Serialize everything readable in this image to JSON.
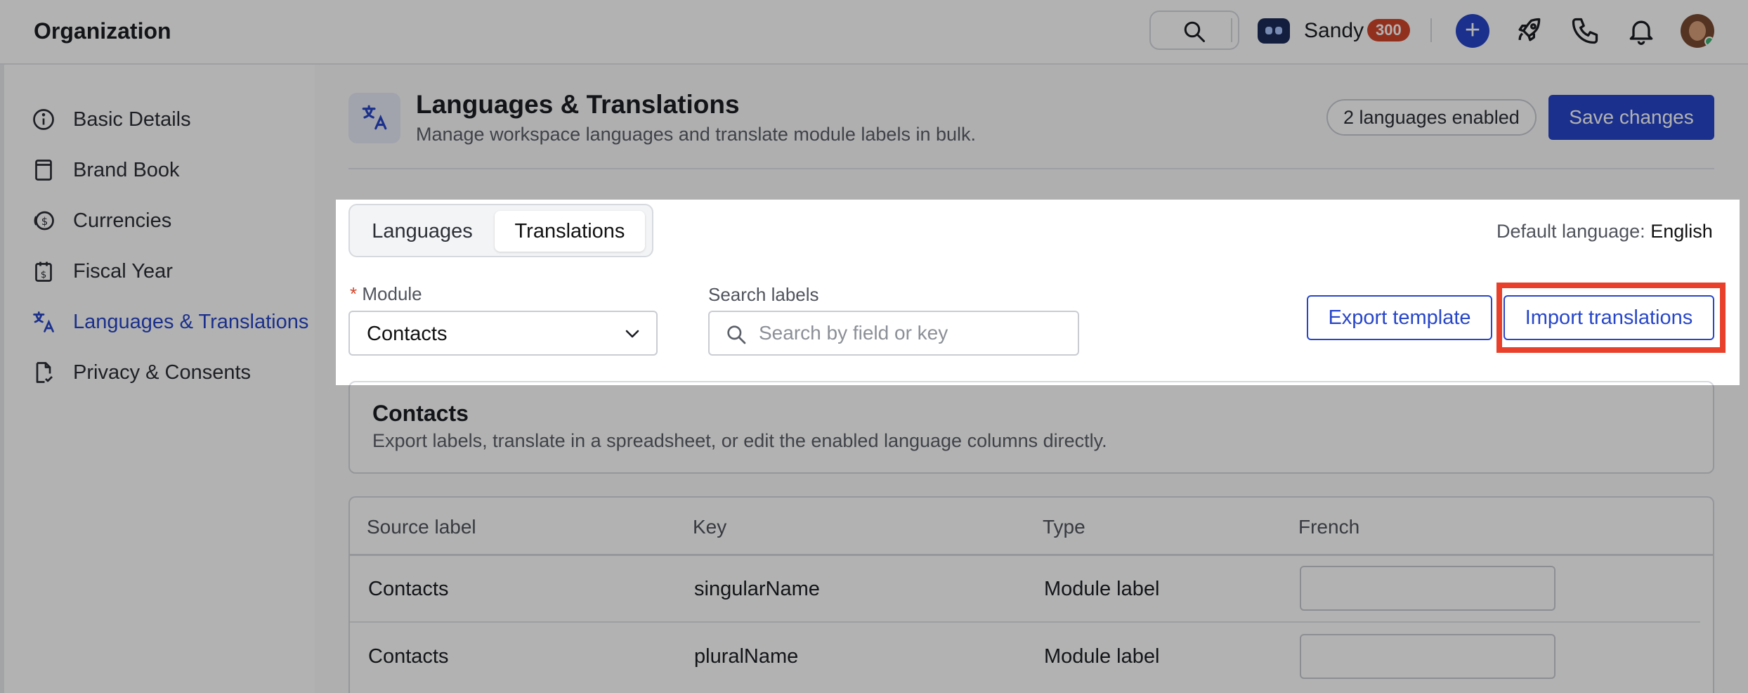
{
  "header": {
    "org_title": "Organization",
    "user_name": "Sandy",
    "count_badge": "300"
  },
  "sidebar": {
    "items": [
      {
        "label": "Basic Details",
        "icon": "info-icon",
        "active": false
      },
      {
        "label": "Brand Book",
        "icon": "book-icon",
        "active": false
      },
      {
        "label": "Currencies",
        "icon": "coins-icon",
        "active": false
      },
      {
        "label": "Fiscal Year",
        "icon": "calendar-dollar-icon",
        "active": false
      },
      {
        "label": "Languages & Translations",
        "icon": "translate-icon",
        "active": true
      },
      {
        "label": "Privacy & Consents",
        "icon": "document-check-icon",
        "active": false
      }
    ]
  },
  "page": {
    "title": "Languages & Translations",
    "subtitle": "Manage workspace languages and translate module labels in bulk.",
    "languages_pill": "2 languages enabled",
    "save_label": "Save changes"
  },
  "tabs": [
    {
      "label": "Languages",
      "selected": false
    },
    {
      "label": "Translations",
      "selected": true
    }
  ],
  "default_language": {
    "label": "Default language:",
    "value": "English"
  },
  "filters": {
    "module_label": "Module",
    "required_mark": "*",
    "module_value": "Contacts",
    "search_label": "Search labels",
    "search_placeholder": "Search by field or key",
    "search_value": ""
  },
  "actions": {
    "export_label": "Export template",
    "import_label": "Import translations"
  },
  "section": {
    "title": "Contacts",
    "description": "Export labels, translate in a spreadsheet, or edit the enabled language columns directly."
  },
  "table": {
    "columns": [
      "Source label",
      "Key",
      "Type",
      "French"
    ],
    "rows": [
      {
        "source": "Contacts",
        "key": "singularName",
        "type": "Module label",
        "french": ""
      },
      {
        "source": "Contacts",
        "key": "pluralName",
        "type": "Module label",
        "french": ""
      }
    ]
  },
  "colors": {
    "accent": "#2746c9",
    "badge": "#d2462c",
    "highlight_outline": "#e8402a",
    "overlay": "rgba(0,0,0,0.30)"
  }
}
